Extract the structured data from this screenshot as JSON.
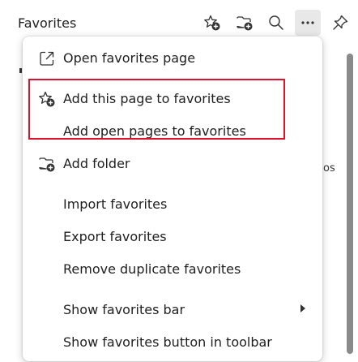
{
  "panel": {
    "title": "Favorites",
    "background_partial_text": "os"
  },
  "header_icons": [
    "star-add-icon",
    "folder-add-icon",
    "search-icon",
    "more-icon",
    "pin-icon"
  ],
  "menu": {
    "items": [
      {
        "label": "Open favorites page",
        "icon": "open-external-icon"
      },
      {
        "label": "Add this page to favorites",
        "icon": "star-add-icon"
      },
      {
        "label": "Add open pages to favorites"
      },
      {
        "label": "Add folder",
        "icon": "folder-add-icon"
      },
      {
        "label": "Import favorites"
      },
      {
        "label": "Export favorites"
      },
      {
        "label": "Remove duplicate favorites"
      },
      {
        "label": "Show favorites bar",
        "has_submenu": true
      },
      {
        "label": "Show favorites button in toolbar"
      }
    ]
  },
  "colors": {
    "highlight_border": "#e0112b",
    "text": "#1f1f1f",
    "active_button_bg": "#e8e8e8"
  }
}
